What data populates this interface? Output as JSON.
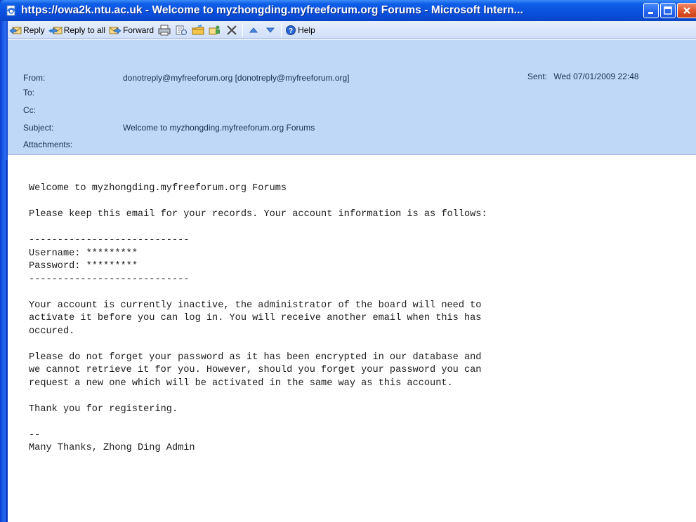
{
  "window": {
    "title": "https://owa2k.ntu.ac.uk - Welcome to myzhongding.myfreeforum.org Forums - Microsoft Intern..."
  },
  "toolbar": {
    "reply_label": "Reply",
    "reply_all_label": "Reply to all",
    "forward_label": "Forward",
    "help_label": "Help"
  },
  "header": {
    "from_label": "From:",
    "from_value": "donotreply@myfreeforum.org [donotreply@myfreeforum.org]",
    "to_label": "To:",
    "cc_label": "Cc:",
    "subject_label": "Subject:",
    "subject_value": "Welcome to myzhongding.myfreeforum.org Forums",
    "attachments_label": "Attachments:",
    "sent_label": "Sent:",
    "sent_value": "Wed 07/01/2009 22:48"
  },
  "message": {
    "body": "Welcome to myzhongding.myfreeforum.org Forums\n\nPlease keep this email for your records. Your account information is as follows:\n\n----------------------------\nUsername: *********\nPassword: *********\n----------------------------\n\nYour account is currently inactive, the administrator of the board will need to\nactivate it before you can log in. You will receive another email when this has\noccured.\n\nPlease do not forget your password as it has been encrypted in our database and\nwe cannot retrieve it for you. However, should you forget your password you can\nrequest a new one which will be activated in the same way as this account.\n\nThank you for registering.\n\n--\nMany Thanks, Zhong Ding Admin"
  },
  "icons": {
    "title": "ie-page-icon",
    "reply": "reply-icon",
    "reply_all": "reply-all-icon",
    "forward": "forward-icon",
    "print": "print-icon",
    "move": "move-to-folder-icon",
    "copy": "copy-to-folder-icon",
    "addresses": "address-book-icon",
    "delete": "delete-icon",
    "previous": "previous-item-icon",
    "next": "next-item-icon",
    "help": "help-icon"
  },
  "colors": {
    "titlebar": "#0a52df",
    "toolbar": "#d0def8",
    "header": "#bfd8f8",
    "close": "#e2582e"
  }
}
